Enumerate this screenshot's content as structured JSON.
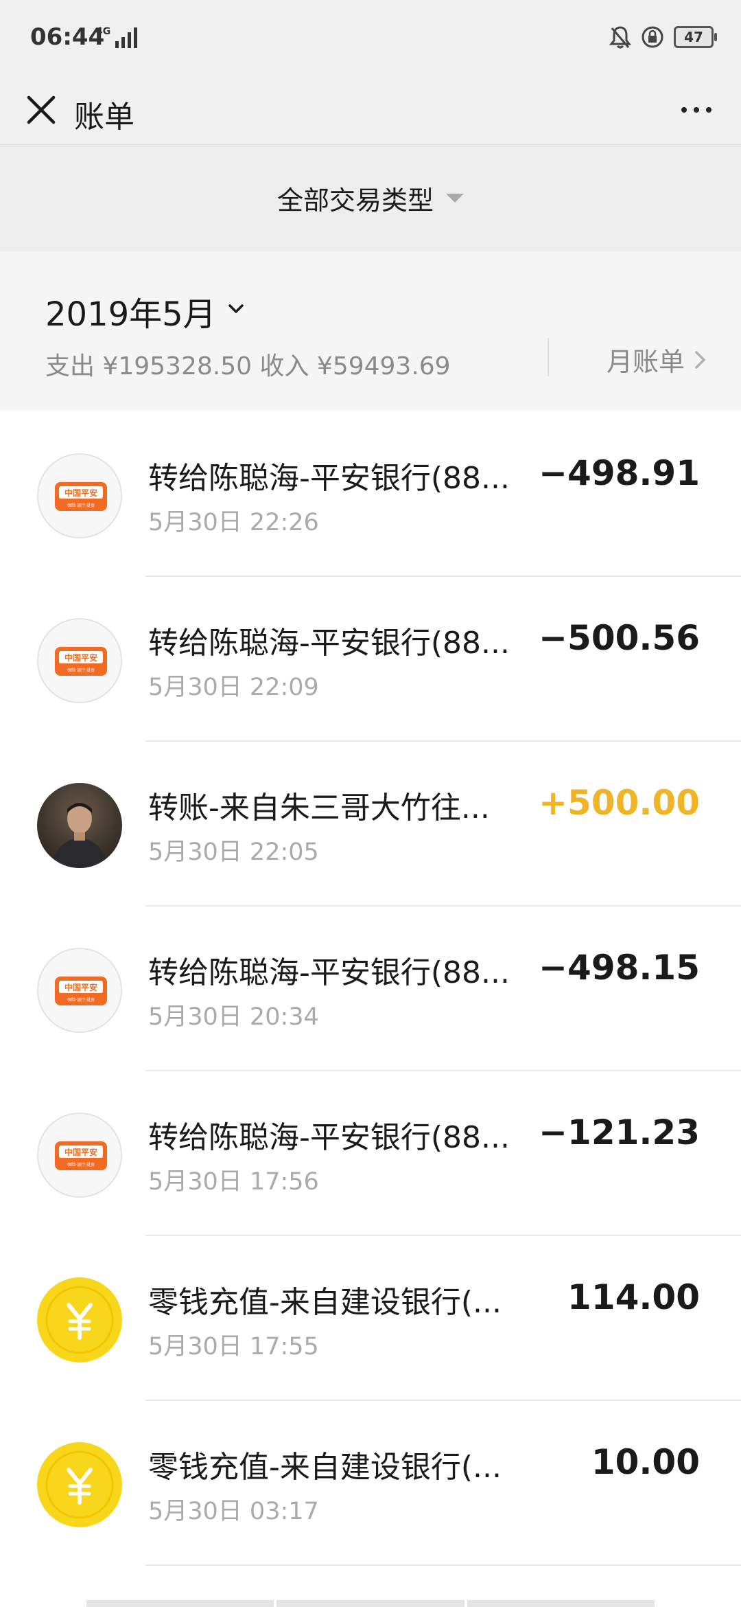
{
  "status_bar": {
    "time": "06:44",
    "network": "4G",
    "battery": "47"
  },
  "nav": {
    "title": "账单"
  },
  "filter": {
    "label": "全部交易类型"
  },
  "month": {
    "title": "2019年5月",
    "summary": "支出 ¥195328.50 收入 ¥59493.69",
    "bill_link": "月账单"
  },
  "transactions": [
    {
      "title": "转给陈聪海-平安银行(88...",
      "time": "5月30日 22:26",
      "amount": "−498.91",
      "avatar": "bank"
    },
    {
      "title": "转给陈聪海-平安银行(88...",
      "time": "5月30日 22:09",
      "amount": "−500.56",
      "avatar": "bank"
    },
    {
      "title": "转账-来自朱三哥大竹往...",
      "time": "5月30日 22:05",
      "amount": "+500.00",
      "avatar": "photo"
    },
    {
      "title": "转给陈聪海-平安银行(88...",
      "time": "5月30日 20:34",
      "amount": "−498.15",
      "avatar": "bank"
    },
    {
      "title": "转给陈聪海-平安银行(88...",
      "time": "5月30日 17:56",
      "amount": "−121.23",
      "avatar": "bank"
    },
    {
      "title": "零钱充值-来自建设银行(...",
      "time": "5月30日 17:55",
      "amount": "114.00",
      "avatar": "coin"
    },
    {
      "title": "零钱充值-来自建设银行(...",
      "time": "5月30日 03:17",
      "amount": "10.00",
      "avatar": "coin"
    }
  ],
  "bank_logo": {
    "name": "中国平安",
    "sub": "保险·银行·投资"
  },
  "colors": {
    "income": "#f0b429",
    "coin": "#f8d61b",
    "bank_orange": "#f26b22"
  }
}
